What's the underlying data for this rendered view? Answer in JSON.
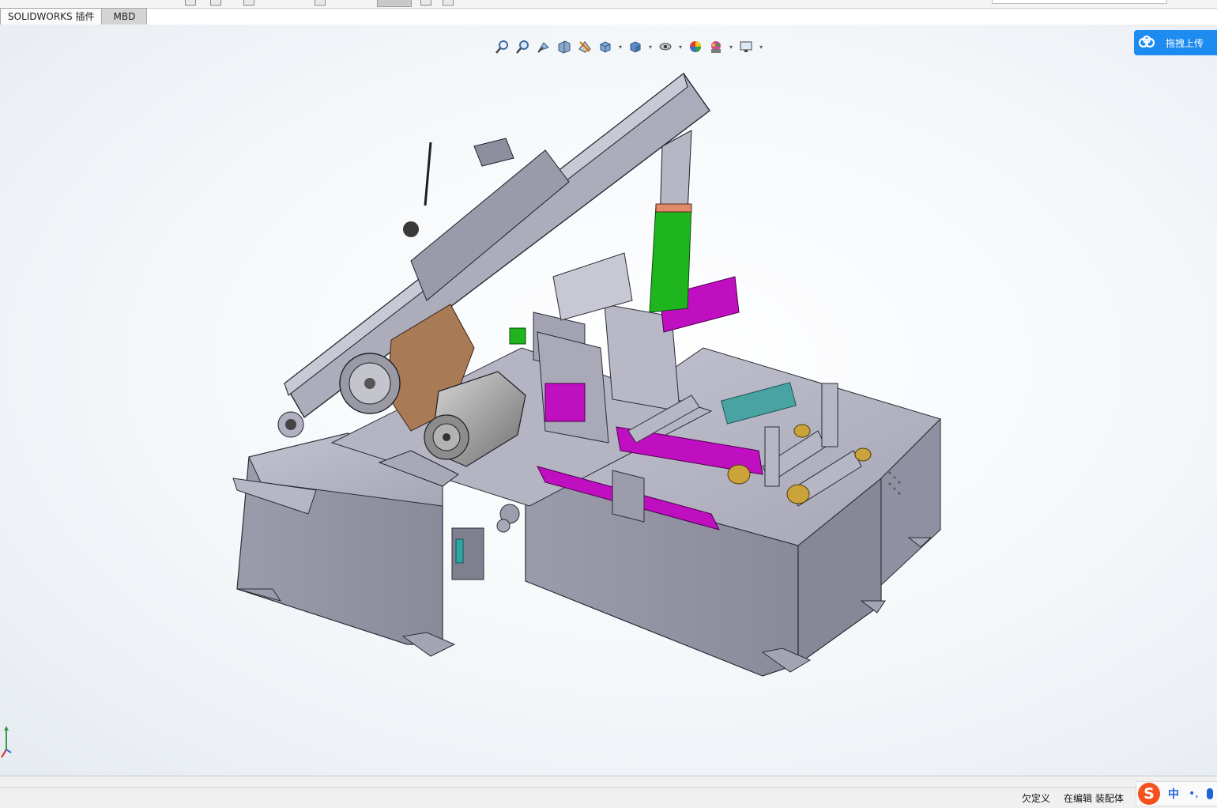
{
  "tabs": [
    {
      "label": "SOLIDWORKS 插件",
      "active": true
    },
    {
      "label": "MBD",
      "active": false
    }
  ],
  "heads_up_toolbar": [
    {
      "icon": "zoom-to-fit-icon",
      "has_dropdown": false
    },
    {
      "icon": "zoom-to-area-icon",
      "has_dropdown": false
    },
    {
      "icon": "previous-view-icon",
      "has_dropdown": false
    },
    {
      "icon": "section-view-icon",
      "has_dropdown": false
    },
    {
      "icon": "dynamic-annotation-views-icon",
      "has_dropdown": false
    },
    {
      "icon": "view-orientation-icon",
      "has_dropdown": true
    },
    {
      "icon": "display-style-icon",
      "has_dropdown": true
    },
    {
      "icon": "hide-show-items-icon",
      "has_dropdown": true
    },
    {
      "icon": "edit-appearance-icon",
      "has_dropdown": false
    },
    {
      "icon": "apply-scene-icon",
      "has_dropdown": true
    },
    {
      "icon": "view-settings-icon",
      "has_dropdown": true
    }
  ],
  "upload_widget": {
    "label": "拖拽上传",
    "icon": "cloud-upload-icon"
  },
  "viewport": {
    "content": "sawing-machine-assembly-model",
    "colors": {
      "frame": "#8c8c9e",
      "motor": "#a0a0a0",
      "gearbox": "#a87a55",
      "hydraulic": "#c00fc0",
      "guide-column": "#1fb51f",
      "valve-block": "#4aa3a3"
    }
  },
  "status": {
    "definition": "欠定义",
    "mode": "在编辑 装配体"
  },
  "ime": {
    "logo": "S",
    "lang": "中",
    "punct": "•,"
  }
}
